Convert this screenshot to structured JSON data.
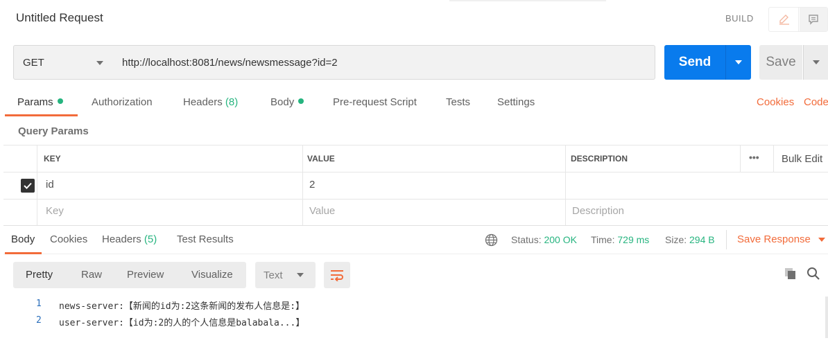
{
  "window": {
    "title": "Untitled Request",
    "build_label": "BUILD"
  },
  "request": {
    "method": "GET",
    "url": "http://localhost:8081/news/newsmessage?id=2",
    "send_label": "Send",
    "save_label": "Save"
  },
  "request_tabs": [
    {
      "label": "Params",
      "dot": true
    },
    {
      "label": "Authorization"
    },
    {
      "label": "Headers",
      "count": "(8)"
    },
    {
      "label": "Body",
      "dot": true
    },
    {
      "label": "Pre-request Script"
    },
    {
      "label": "Tests"
    },
    {
      "label": "Settings"
    }
  ],
  "links": {
    "cookies": "Cookies",
    "code": "Code"
  },
  "query_params": {
    "title": "Query Params",
    "headers": {
      "key": "KEY",
      "value": "VALUE",
      "description": "DESCRIPTION"
    },
    "more": "•••",
    "bulk_edit": "Bulk Edit",
    "rows": [
      {
        "checked": true,
        "key": "id",
        "value": "2",
        "description": ""
      }
    ],
    "placeholders": {
      "key": "Key",
      "value": "Value",
      "description": "Description"
    }
  },
  "response_tabs": [
    {
      "label": "Body"
    },
    {
      "label": "Cookies"
    },
    {
      "label": "Headers",
      "count": "(5)"
    },
    {
      "label": "Test Results"
    }
  ],
  "status": {
    "status_label": "Status:",
    "status_value": "200 OK",
    "time_label": "Time:",
    "time_value": "729 ms",
    "size_label": "Size:",
    "size_value": "294 B",
    "save_response": "Save Response"
  },
  "viewer": {
    "modes": [
      "Pretty",
      "Raw",
      "Preview",
      "Visualize"
    ],
    "format": "Text"
  },
  "body_lines": [
    {
      "n": "1",
      "text": "news-server:【新闻的id为:2这条新闻的发布人信息是:】"
    },
    {
      "n": "2",
      "text": "user-server:【id为:2的人的个人信息是balabala...】"
    }
  ],
  "colors": {
    "accent": "#f26b3a",
    "send": "#097bed",
    "success": "#26b47f"
  }
}
